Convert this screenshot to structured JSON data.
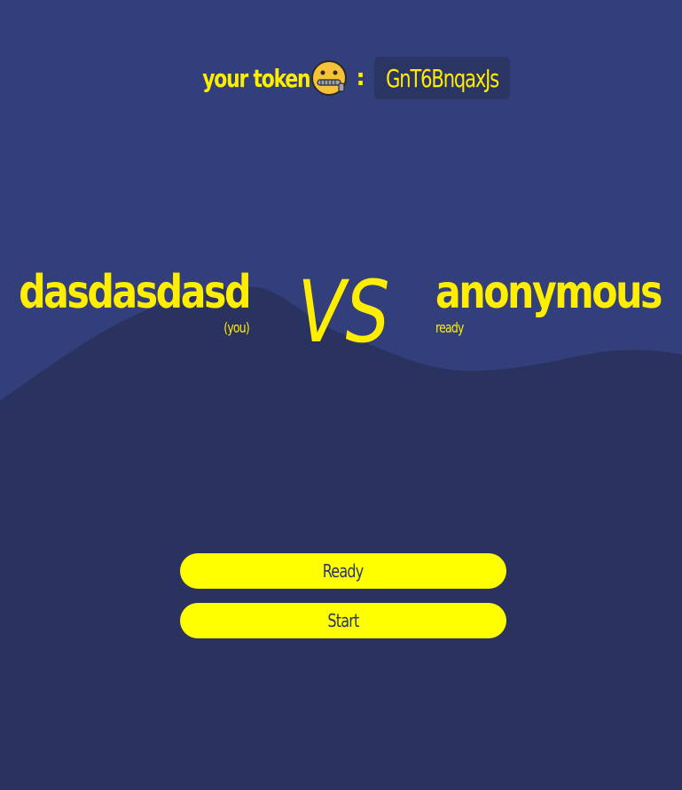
{
  "token": {
    "label": "your token",
    "icon": "zipper-mouth-face-icon",
    "separator": ":",
    "value": "GnT6BnqaxJs"
  },
  "players": {
    "left": {
      "name": "dasdasdasd",
      "sub": "(you)"
    },
    "right": {
      "name": "anonymous",
      "sub": "ready"
    }
  },
  "vs_label": "VS",
  "buttons": {
    "ready_label": "Ready",
    "start_label": "Start"
  },
  "colors": {
    "background_top": "#323f7b",
    "background_bottom": "#2a335f",
    "accent": "#ffee00",
    "button_bg": "#ffff00",
    "button_text": "#2b3563"
  }
}
